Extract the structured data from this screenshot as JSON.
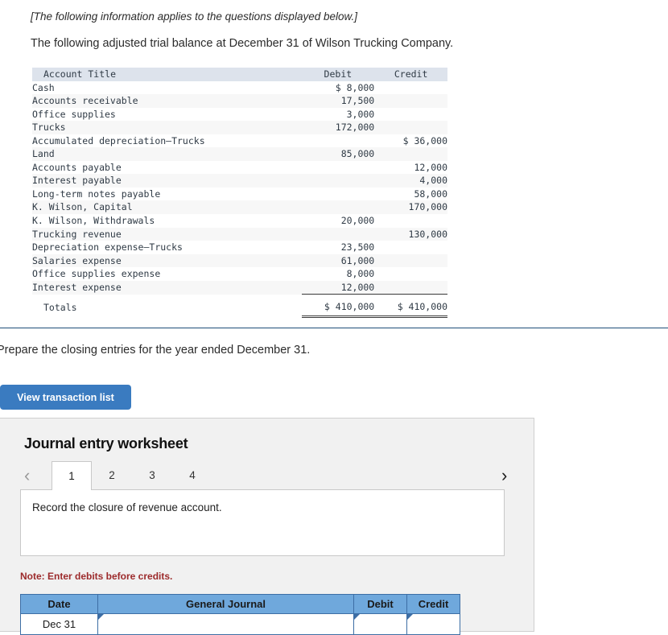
{
  "intro": {
    "bracket_note": "[The following information applies to the questions displayed below.]",
    "lead_in": "The following adjusted trial balance at December 31 of Wilson Trucking Company."
  },
  "trial_balance": {
    "columns": [
      "Account Title",
      "Debit",
      "Credit"
    ],
    "rows": [
      {
        "title": "Cash",
        "debit": "$ 8,000",
        "credit": ""
      },
      {
        "title": "Accounts receivable",
        "debit": "17,500",
        "credit": ""
      },
      {
        "title": "Office supplies",
        "debit": "3,000",
        "credit": ""
      },
      {
        "title": "Trucks",
        "debit": "172,000",
        "credit": ""
      },
      {
        "title": "Accumulated depreciation—Trucks",
        "debit": "",
        "credit": "$ 36,000"
      },
      {
        "title": "Land",
        "debit": "85,000",
        "credit": ""
      },
      {
        "title": "Accounts payable",
        "debit": "",
        "credit": "12,000"
      },
      {
        "title": "Interest payable",
        "debit": "",
        "credit": "4,000"
      },
      {
        "title": "Long-term notes payable",
        "debit": "",
        "credit": "58,000"
      },
      {
        "title": "K. Wilson, Capital",
        "debit": "",
        "credit": "170,000"
      },
      {
        "title": "K. Wilson, Withdrawals",
        "debit": "20,000",
        "credit": ""
      },
      {
        "title": "Trucking revenue",
        "debit": "",
        "credit": "130,000"
      },
      {
        "title": "Depreciation expense—Trucks",
        "debit": "23,500",
        "credit": ""
      },
      {
        "title": "Salaries expense",
        "debit": "61,000",
        "credit": ""
      },
      {
        "title": "Office supplies expense",
        "debit": "8,000",
        "credit": ""
      },
      {
        "title": "Interest expense",
        "debit": "12,000",
        "credit": ""
      }
    ],
    "totals": {
      "title": "Totals",
      "debit": "$ 410,000",
      "credit": "$ 410,000"
    }
  },
  "requirement": {
    "text": "Prepare the closing entries for the year ended December 31."
  },
  "buttons": {
    "view_transaction_list": "View transaction list"
  },
  "worksheet": {
    "title": "Journal entry worksheet",
    "prev_icon": "chevron-left-icon",
    "next_icon": "chevron-right-icon",
    "prev_glyph": "‹",
    "next_glyph": "›",
    "tabs": [
      {
        "label": "1",
        "active": true
      },
      {
        "label": "2",
        "active": false
      },
      {
        "label": "3",
        "active": false
      },
      {
        "label": "4",
        "active": false
      }
    ],
    "active_tab": "1",
    "instruction": "Record the closure of revenue account.",
    "note": "Note: Enter debits before credits.",
    "journal_table": {
      "columns": [
        "Date",
        "General Journal",
        "Debit",
        "Credit"
      ],
      "rows": [
        {
          "date": "Dec 31",
          "general_journal": "",
          "debit": "",
          "credit": ""
        }
      ]
    }
  },
  "colors": {
    "accent_blue": "#3a7bc0",
    "table_header_blue": "#6fa8dc",
    "table_header_border": "#3d6ea5",
    "divider_navy": "#1f4e79",
    "tb_header_bg": "#dde3ec",
    "tb_stripe": "#f7f7f7",
    "note_red": "#9c2a2b",
    "panel_bg": "#f1f1f1"
  }
}
